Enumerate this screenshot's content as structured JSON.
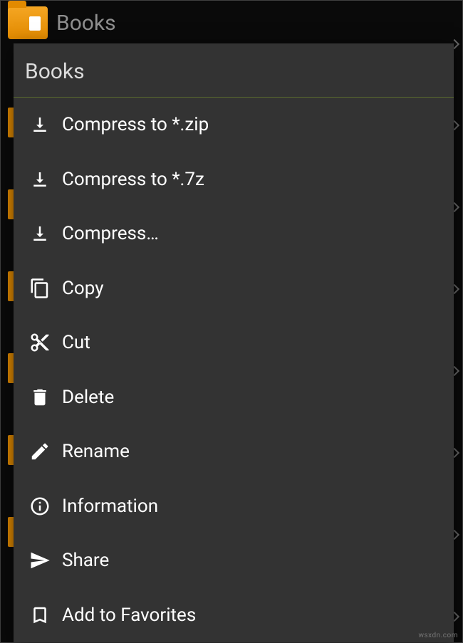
{
  "header": {
    "folder_name": "Books"
  },
  "menu": {
    "title": "Books",
    "items": [
      {
        "icon": "download-icon",
        "label": "Compress to *.zip"
      },
      {
        "icon": "download-icon",
        "label": "Compress to *.7z"
      },
      {
        "icon": "download-icon",
        "label": "Compress…"
      },
      {
        "icon": "copy-icon",
        "label": "Copy"
      },
      {
        "icon": "cut-icon",
        "label": "Cut"
      },
      {
        "icon": "delete-icon",
        "label": "Delete"
      },
      {
        "icon": "rename-icon",
        "label": "Rename"
      },
      {
        "icon": "info-icon",
        "label": "Information"
      },
      {
        "icon": "share-icon",
        "label": "Share"
      },
      {
        "icon": "bookmark-icon",
        "label": "Add to Favorites"
      }
    ]
  },
  "watermark": "wsxdn.com"
}
